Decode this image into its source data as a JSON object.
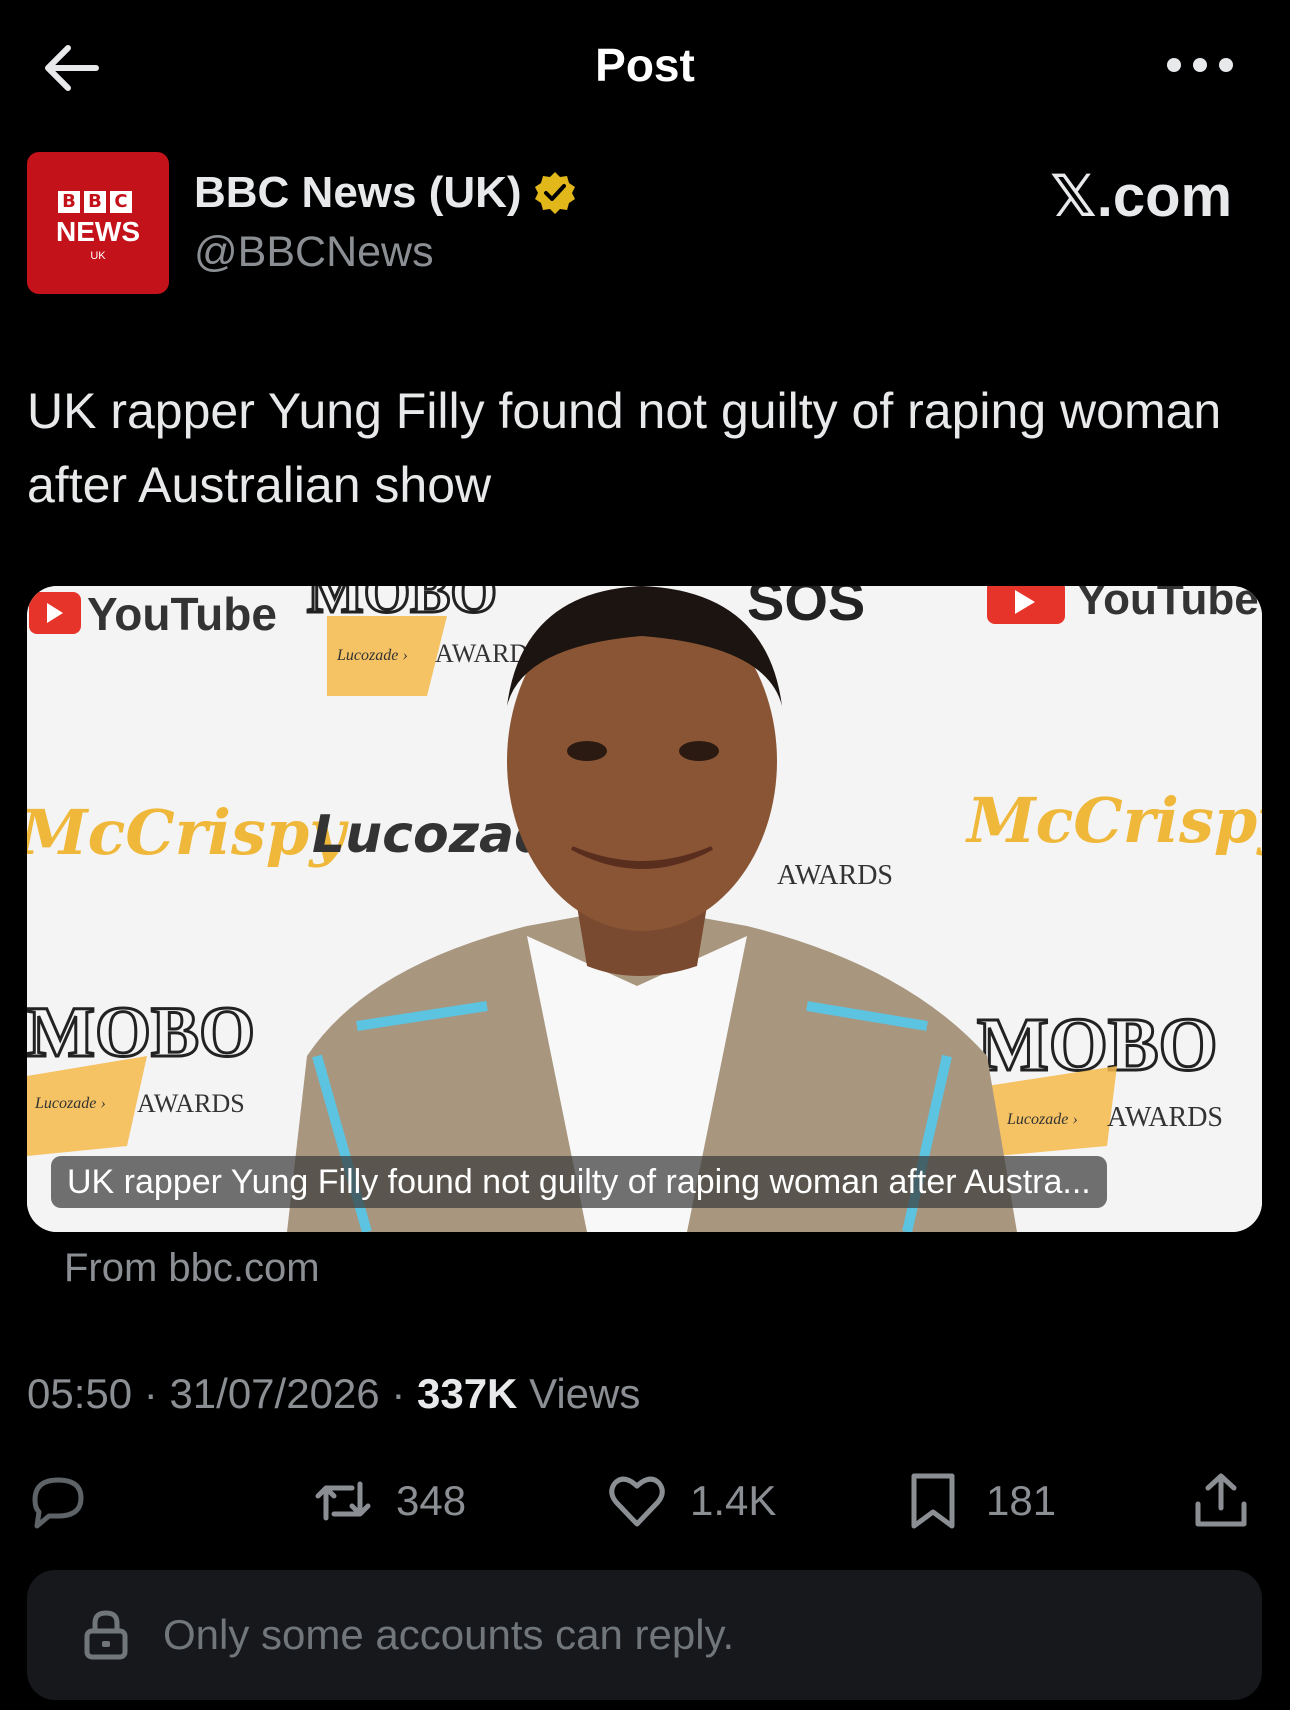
{
  "header": {
    "title": "Post",
    "back_icon": "arrow-left-icon",
    "more_icon": "more-horizontal-icon"
  },
  "author": {
    "avatar_label_blocks": [
      "B",
      "B",
      "C"
    ],
    "avatar_label_main": "NEWS",
    "avatar_label_sub": "UK",
    "name": "BBC News (UK)",
    "handle": "@BBCNews",
    "verified": true,
    "verified_color": "#e2b719",
    "watermark": "𝕏.com"
  },
  "post": {
    "text": "UK rapper Yung Filly found not guilty of raping woman after Australian show"
  },
  "card": {
    "caption": "UK rapper Yung Filly found not guilty of raping woman after Austra...",
    "source": "From bbc.com",
    "backdrop_logos": [
      "YouTube",
      "MOBO",
      "Lucozade",
      "AWARDS",
      "McCrispy"
    ]
  },
  "meta": {
    "time": "05:50",
    "date": "31/07/2026",
    "views_count": "337K",
    "views_label": "Views"
  },
  "actions": {
    "reply_count": "",
    "retweet_count": "348",
    "like_count": "1.4K",
    "bookmark_count": "181"
  },
  "reply_restriction": {
    "text": "Only some accounts can reply."
  },
  "colors": {
    "background": "#000000",
    "text_primary": "#e7e9ea",
    "text_secondary": "#8b8f94",
    "bbc_red": "#c4121a"
  }
}
